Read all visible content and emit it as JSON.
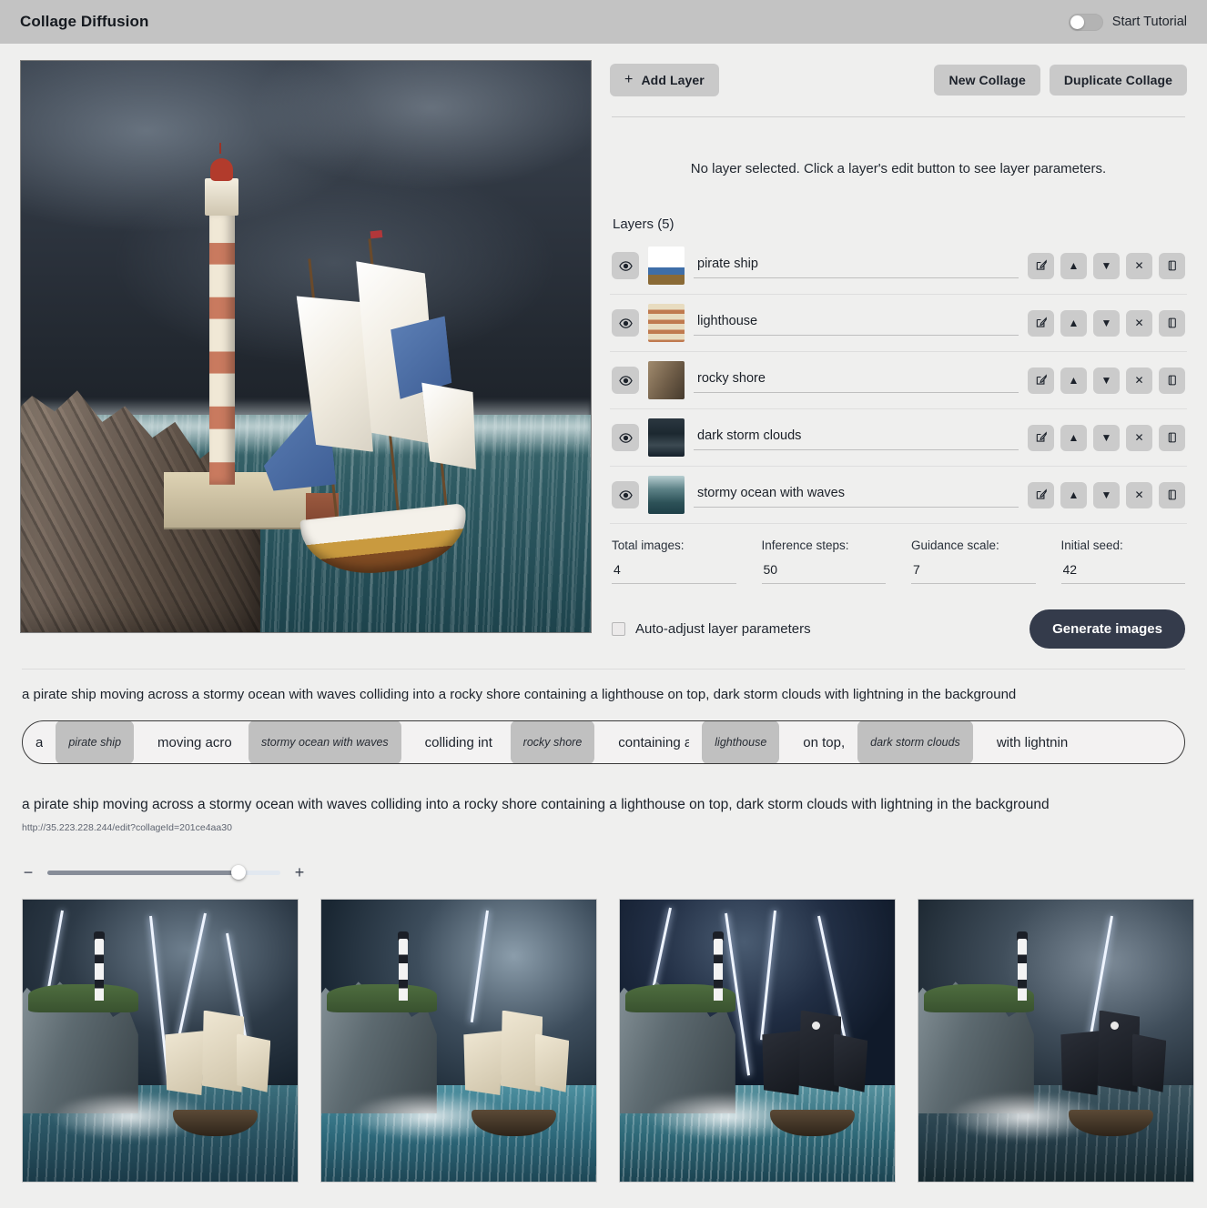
{
  "header": {
    "app_title": "Collage Diffusion",
    "tutorial_label": "Start Tutorial",
    "tutorial_on": false
  },
  "toolbar": {
    "add_layer_label": "Add Layer",
    "add_layer_plus": "+",
    "new_collage_label": "New Collage",
    "duplicate_collage_label": "Duplicate Collage"
  },
  "panel": {
    "no_layer_message": "No layer selected. Click a layer's edit button to see layer parameters.",
    "layers_heading": "Layers (5)",
    "layer_count": 5
  },
  "layers": [
    {
      "name": "pirate ship",
      "visible": true,
      "thumb": "ship-thumbnail-icon"
    },
    {
      "name": "lighthouse",
      "visible": true,
      "thumb": "lighthouse-thumbnail-icon"
    },
    {
      "name": "rocky shore",
      "visible": true,
      "thumb": "rock-thumbnail-icon"
    },
    {
      "name": "dark storm clouds",
      "visible": true,
      "thumb": "clouds-thumbnail-icon"
    },
    {
      "name": "stormy ocean with waves",
      "visible": true,
      "thumb": "ocean-thumbnail-icon"
    }
  ],
  "layer_actions": {
    "edit": "edit-icon",
    "move_up": "▲",
    "move_down": "▼",
    "delete": "✕",
    "duplicate": "duplicate-icon",
    "visibility": "eye-icon"
  },
  "params": [
    {
      "label": "Total images:",
      "value": "4"
    },
    {
      "label": "Inference steps:",
      "value": "50"
    },
    {
      "label": "Guidance scale:",
      "value": "7"
    },
    {
      "label": "Initial seed:",
      "value": "42"
    }
  ],
  "bottom": {
    "auto_adjust_label": "Auto-adjust layer parameters",
    "auto_adjust_checked": false,
    "generate_label": "Generate images"
  },
  "prompt": {
    "full_text": "a pirate ship moving across a stormy ocean with waves colliding into a rocky shore containing a lighthouse on top, dark storm clouds with lightning in the background",
    "tokens": [
      {
        "type": "text",
        "value": "a"
      },
      {
        "type": "chip",
        "value": "pirate ship"
      },
      {
        "type": "text",
        "value": "moving acro"
      },
      {
        "type": "chip",
        "value": "stormy ocean with waves"
      },
      {
        "type": "text",
        "value": "colliding int"
      },
      {
        "type": "chip",
        "value": "rocky shore"
      },
      {
        "type": "text",
        "value": "containing a"
      },
      {
        "type": "chip",
        "value": "lighthouse"
      },
      {
        "type": "text",
        "value": "on top,"
      },
      {
        "type": "chip",
        "value": "dark storm clouds"
      },
      {
        "type": "text",
        "value": "with lightnin"
      }
    ]
  },
  "result": {
    "title": "a pirate ship moving across a stormy ocean with waves colliding into a rocky shore containing a lighthouse on top, dark storm clouds with lightning in the background",
    "url": "http://35.223.228.244/edit?collageId=201ce4aa30"
  },
  "slider": {
    "minus": "−",
    "plus": "+",
    "value_percent": 82
  },
  "gallery": {
    "count": 4,
    "items": [
      {
        "alt": "generated pirate ship with lighthouse and lightning 1"
      },
      {
        "alt": "generated pirate ship with lighthouse and lightning 2"
      },
      {
        "alt": "generated pirate ship with lighthouse and lightning 3"
      },
      {
        "alt": "generated pirate ship with lighthouse and lightning 4"
      }
    ]
  },
  "colors": {
    "header_bg": "#c3c3c3",
    "page_bg": "#efefee",
    "button_bg": "#c9c9c9",
    "chip_bg": "#c0c0c0",
    "generate_bg": "#343b4b",
    "slider_fill": "#878d98"
  }
}
